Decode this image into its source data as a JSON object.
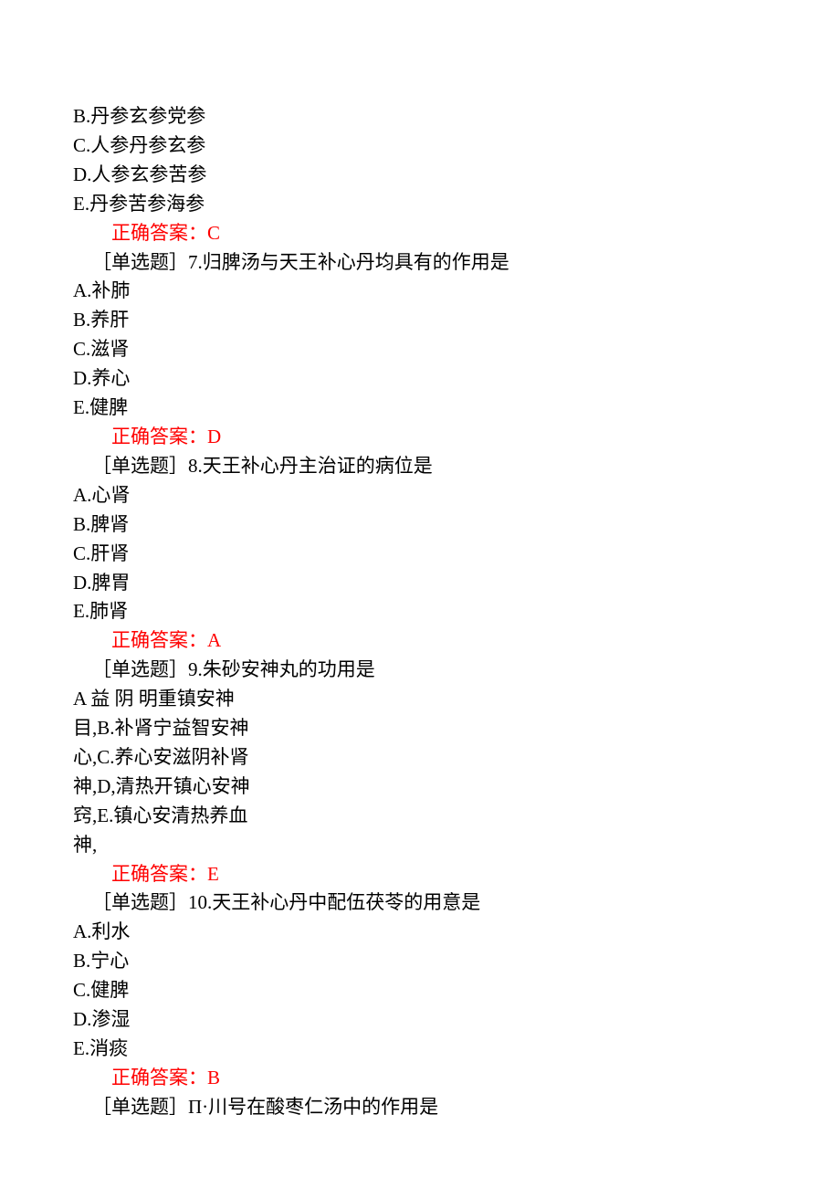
{
  "q6": {
    "optB": "B.丹参玄参党参",
    "optC": "C.人参丹参玄参",
    "optD": "D.人参玄参苦参",
    "optE": "E.丹参苦参海参",
    "answer": "正确答案：C"
  },
  "q7": {
    "stem": "［单选题］7.归脾汤与天王补心丹均具有的作用是",
    "optA": "A.补肺",
    "optB": "B.养肝",
    "optC": "C.滋肾",
    "optD": "D.养心",
    "optE": "E.健脾",
    "answer": "正确答案：D"
  },
  "q8": {
    "stem": "［单选题］8.天王补心丹主治证的病位是",
    "optA": "A.心肾",
    "optB": "B.脾肾",
    "optC": "C.肝肾",
    "optD": "D.脾胃",
    "optE": "E.肺肾",
    "answer": "正确答案：A"
  },
  "q9": {
    "stem": "［单选题］9.朱砂安神丸的功用是",
    "line1a": "A  益  阴  明",
    "line1b": "重镇安神",
    "line2a": "目,B.补肾宁",
    "line2b": "益智安神",
    "line3a": "心,C.养心安",
    "line3b": "滋阴补肾",
    "line4a": "神,D,清热开",
    "line4b": "镇心安神",
    "line5a": "窍,E.镇心安",
    "line5b": "清热养血",
    "line6": "神,",
    "answer": "正确答案：E"
  },
  "q10": {
    "stem": "［单选题］10.天王补心丹中配伍茯苓的用意是",
    "optA": "A.利水",
    "optB": "B.宁心",
    "optC": "C.健脾",
    "optD": "D.渗湿",
    "optE": "E.消痰",
    "answer": "正确答案：B"
  },
  "q11": {
    "stem": "［单选题］Π·川号在酸枣仁汤中的作用是"
  }
}
